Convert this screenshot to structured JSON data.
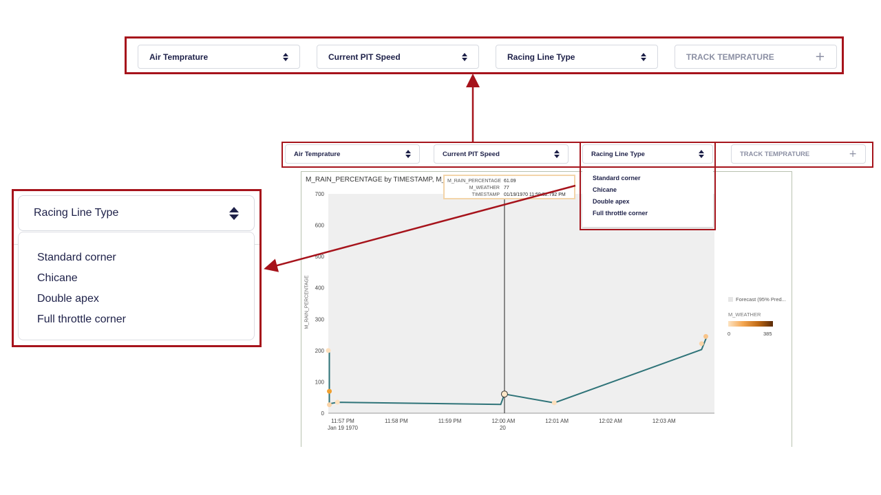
{
  "top_bar": {
    "filters": [
      {
        "label": "Air Temprature"
      },
      {
        "label": "Current PIT Speed"
      },
      {
        "label": "Racing Line Type"
      },
      {
        "label": "TRACK TEMPRATURE"
      }
    ]
  },
  "mid_bar": {
    "filters": [
      {
        "label": "Air Temprature"
      },
      {
        "label": "Current PIT Speed"
      },
      {
        "label": "Racing Line Type"
      },
      {
        "label": "TRACK TEMPRATURE"
      }
    ]
  },
  "dropdown": {
    "title": "Racing Line Type",
    "options": [
      "Standard corner",
      "Chicane",
      "Double apex",
      "Full throttle corner"
    ]
  },
  "zoom_dropdown": {
    "title": "Racing Line Type",
    "options": [
      "Standard corner",
      "Chicane",
      "Double apex",
      "Full throttle corner"
    ]
  },
  "chart": {
    "title": "M_RAIN_PERCENTAGE by TIMESTAMP, M_WEA",
    "ylabel": "M_RAIN_PERCENTAGE",
    "tooltip": {
      "rows": [
        {
          "key": "M_RAIN_PERCENTAGE",
          "value": "61.09"
        },
        {
          "key": "M_WEATHER",
          "value": "77"
        },
        {
          "key": "TIMESTAMP",
          "value": "01/19/1970 11:59:52.792 PM"
        }
      ]
    },
    "legend": {
      "forecast_label": "Forecast (95% Pred...",
      "color_title": "M_WEATHER",
      "min": "0",
      "max": "385"
    }
  },
  "chart_data": {
    "type": "line",
    "title": "M_RAIN_PERCENTAGE by TIMESTAMP, M_WEA",
    "ylabel": "M_RAIN_PERCENTAGE",
    "xlabel": "",
    "ylim": [
      0,
      700
    ],
    "y_ticks": [
      "0",
      "100",
      "200",
      "300",
      "400",
      "500",
      "600",
      "700"
    ],
    "x_ticks": [
      {
        "label": "11:57 PM",
        "sub": "Jan 19 1970",
        "t": 0
      },
      {
        "label": "11:58 PM",
        "sub": "",
        "t": 1
      },
      {
        "label": "11:59 PM",
        "sub": "",
        "t": 2
      },
      {
        "label": "12:00 AM",
        "sub": "20",
        "t": 3
      },
      {
        "label": "12:01 AM",
        "sub": "",
        "t": 4
      },
      {
        "label": "12:02 AM",
        "sub": "",
        "t": 5
      },
      {
        "label": "12:03 AM",
        "sub": "",
        "t": 6
      }
    ],
    "line_color": "#2e7378",
    "grid": false,
    "series": [
      {
        "points": [
          {
            "t": -0.25,
            "y": 200
          },
          {
            "t": -0.25,
            "y": 30
          },
          {
            "t": -0.1,
            "y": 35
          },
          {
            "t": 2.95,
            "y": 28
          },
          {
            "t": 3.02,
            "y": 61
          },
          {
            "t": 3.95,
            "y": 33
          },
          {
            "t": 6.7,
            "y": 203
          },
          {
            "t": 6.8,
            "y": 245
          }
        ]
      }
    ],
    "markers": [
      {
        "t": -0.27,
        "y": 200,
        "color": "#fde0bd"
      },
      {
        "t": -0.25,
        "y": 70,
        "color": "#f0a030"
      },
      {
        "t": -0.25,
        "y": 27,
        "color": "#fbd4a8"
      },
      {
        "t": -0.1,
        "y": 35,
        "color": "#fde0bd"
      },
      {
        "t": 3.02,
        "y": 61,
        "color": "#fde7c9"
      },
      {
        "t": 3.95,
        "y": 33,
        "color": "#fde0bd"
      },
      {
        "t": 6.7,
        "y": 222,
        "color": "#fbd4a8"
      },
      {
        "t": 6.78,
        "y": 245,
        "color": "#f8c48a"
      }
    ],
    "hover_t": 3.02
  }
}
